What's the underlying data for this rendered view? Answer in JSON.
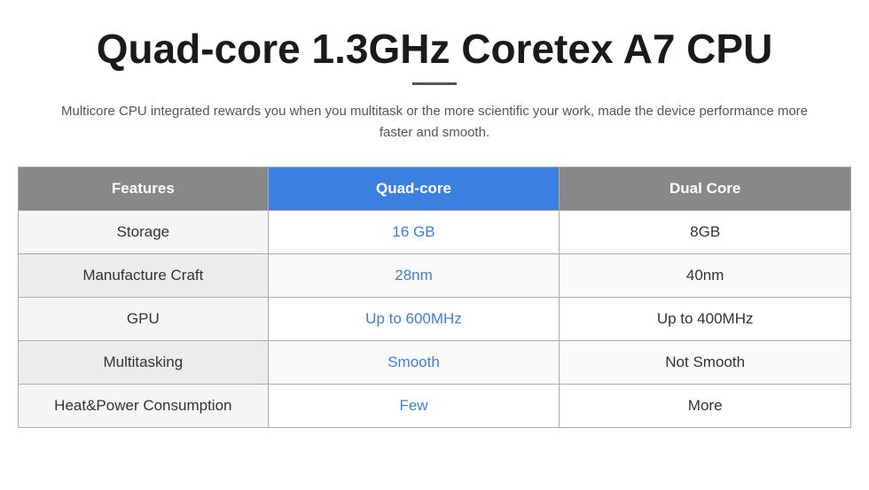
{
  "page": {
    "title": "Quad-core 1.3GHz Coretex A7 CPU",
    "subtitle": "Multicore CPU integrated rewards you when you multitask or the more scientific your work, made the device performance more faster and smooth.",
    "divider_color": "#555555"
  },
  "table": {
    "headers": {
      "features": "Features",
      "quad": "Quad-core",
      "dual": "Dual Core"
    },
    "rows": [
      {
        "feature": "Storage",
        "quad_value": "16 GB",
        "dual_value": "8GB"
      },
      {
        "feature": "Manufacture Craft",
        "quad_value": "28nm",
        "dual_value": "40nm"
      },
      {
        "feature": "GPU",
        "quad_value": "Up to 600MHz",
        "dual_value": "Up to 400MHz"
      },
      {
        "feature": "Multitasking",
        "quad_value": "Smooth",
        "dual_value": "Not Smooth"
      },
      {
        "feature": "Heat&Power Consumption",
        "quad_value": "Few",
        "dual_value": "More"
      }
    ]
  }
}
